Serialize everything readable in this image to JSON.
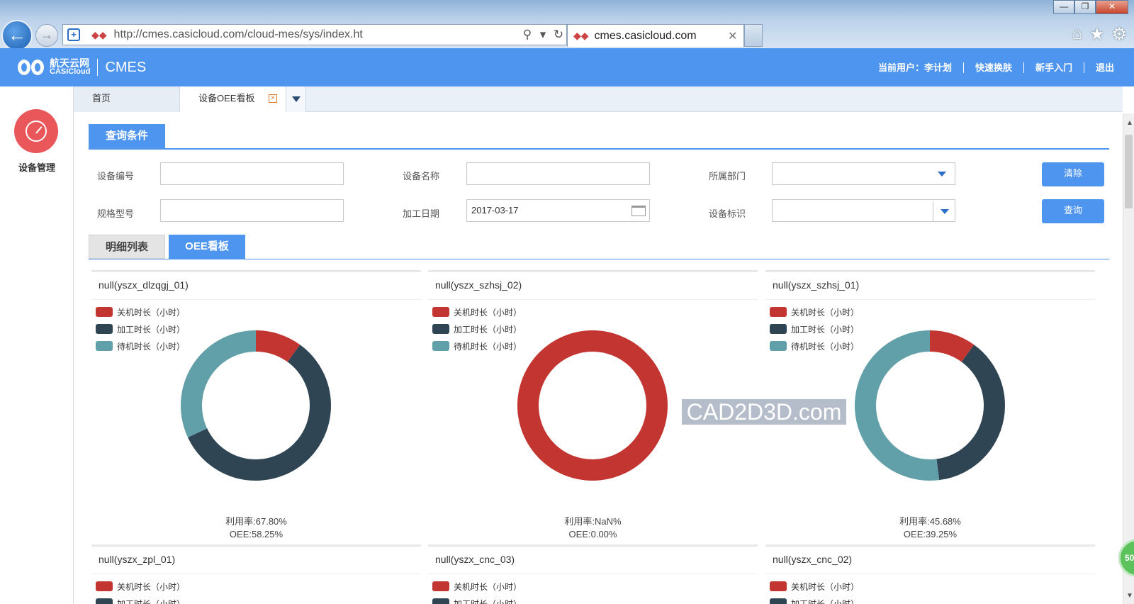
{
  "browser": {
    "url": "http://cmes.casicloud.com/cloud-mes/sys/index.ht",
    "tab_title": "cmes.casicloud.com",
    "window_buttons": {
      "minimize": "—",
      "restore": "❐",
      "close": "✕"
    }
  },
  "app": {
    "brand_cn": "航天云网",
    "brand_en": "CASICloud",
    "product": "CMES",
    "header_links": [
      "当前用户：李计划",
      "快速换肤",
      "新手入门",
      "退出"
    ]
  },
  "sidebar": {
    "module_label": "设备管理"
  },
  "page_tabs": {
    "home": "首页",
    "current": "设备OEE看板"
  },
  "query": {
    "section_title": "查询条件",
    "fields": {
      "equip_code_label": "设备编号",
      "equip_name_label": "设备名称",
      "dept_label": "所属部门",
      "spec_label": "规格型号",
      "date_label": "加工日期",
      "date_value": "2017-03-17",
      "equip_flag_label": "设备标识"
    },
    "clear_btn": "清除",
    "search_btn": "查询"
  },
  "view_tabs": {
    "detail": "明细列表",
    "oee": "OEE看板"
  },
  "legend": {
    "off": "关机时长（小时）",
    "work": "加工时长（小时）",
    "idle": "待机时长（小时）"
  },
  "colors": {
    "off": "#c23531",
    "work": "#2f4554",
    "idle": "#61a0a8",
    "accent": "#4e95f0"
  },
  "cards": [
    {
      "title": "null(yszx_dlzqgj_01)",
      "util": "利用率:67.80%",
      "oee": "OEE:58.25%",
      "segments": {
        "off": 0.1,
        "work": 0.58,
        "idle": 0.32
      }
    },
    {
      "title": "null(yszx_szhsj_02)",
      "util": "利用率:NaN%",
      "oee": "OEE:0.00%",
      "segments": {
        "off": 1.0,
        "work": 0.0,
        "idle": 0.0
      }
    },
    {
      "title": "null(yszx_szhsj_01)",
      "util": "利用率:45.68%",
      "oee": "OEE:39.25%",
      "segments": {
        "off": 0.1,
        "work": 0.38,
        "idle": 0.52
      }
    },
    {
      "title": "null(yszx_zpl_01)"
    },
    {
      "title": "null(yszx_cnc_03)"
    },
    {
      "title": "null(yszx_cnc_02)"
    }
  ],
  "watermark": "CAD2D3D.com",
  "badge": "50"
}
